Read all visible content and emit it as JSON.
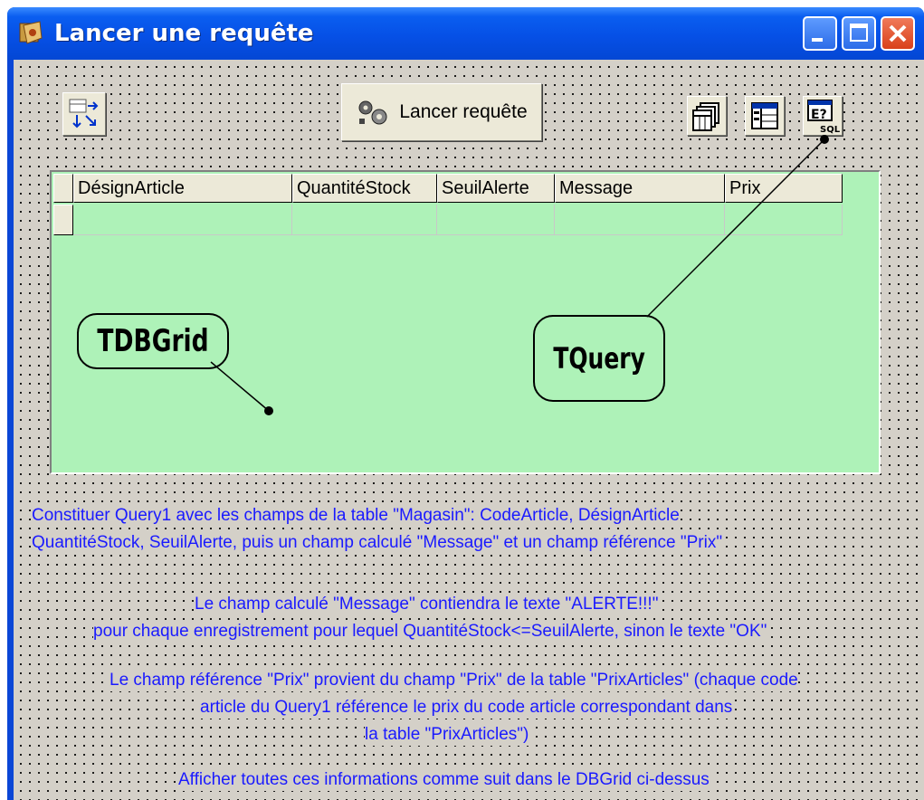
{
  "window": {
    "title": "Lancer une requête",
    "controls": [
      "minimize",
      "maximize",
      "close"
    ]
  },
  "toolbar": {
    "run_query_label": "Lancer requête",
    "left_component_icon": "move-arrows-icon",
    "right_icons": [
      "table-stack-icon",
      "datasource-icon",
      "sql-query-icon"
    ]
  },
  "grid": {
    "columns": [
      "DésignArticle",
      "QuantitéStock",
      "SeuilAlerte",
      "Message",
      "Prix"
    ],
    "rows": [
      [
        "",
        "",
        "",
        "",
        ""
      ]
    ]
  },
  "callouts": {
    "grid": "TDBGrid",
    "query": "TQuery"
  },
  "description": {
    "p1_line1": "Constituer Query1 avec les champs de la table \"Magasin\": CodeArticle, DésignArticle",
    "p1_line2": "QuantitéStock, SeuilAlerte, puis un champ calculé \"Message\" et un champ référence \"Prix\"",
    "p2_line1": "Le champ calculé \"Message\" contiendra le texte \"ALERTE!!!\"",
    "p2_line2": "pour chaque enregistrement pour lequel QuantitéStock<=SeuilAlerte, sinon le texte \"OK\"",
    "p3_line1": "Le champ référence \"Prix\" provient du champ \"Prix\" de la table \"PrixArticles\" (chaque code",
    "p3_line2": "article du Query1 référence le prix du code article correspondant dans",
    "p3_line3": "la table \"PrixArticles\")",
    "p4_line1": "Afficher toutes ces informations comme suit dans le DBGrid ci-dessus"
  },
  "colors": {
    "title_bar": "#0650e6",
    "grid_bg": "#aef2b8",
    "desc_text": "#1a1aff",
    "client_bg": "#d4d0c8"
  }
}
